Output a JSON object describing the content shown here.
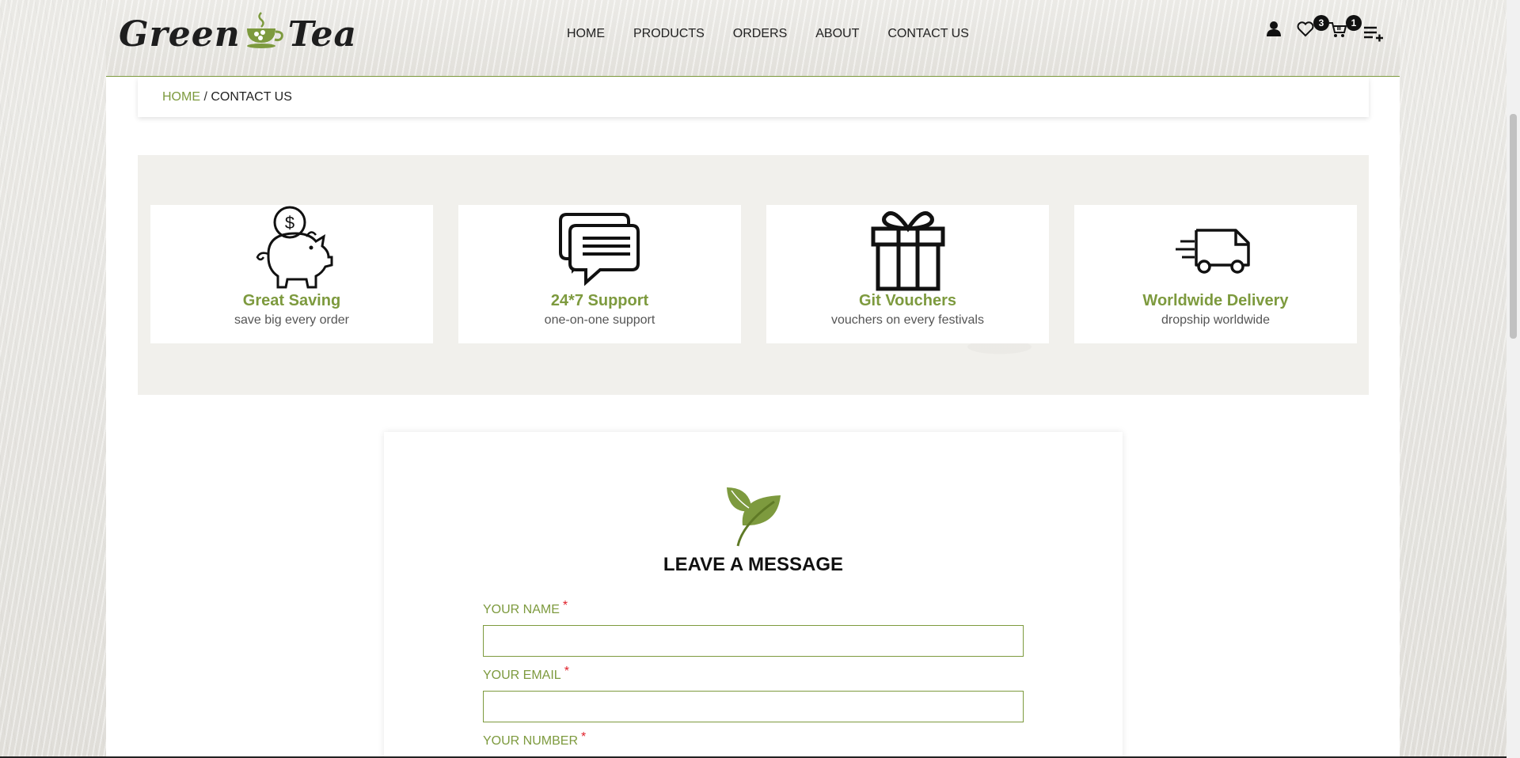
{
  "header": {
    "logo": {
      "word1": "Green",
      "word2": "Tea"
    },
    "nav": [
      "HOME",
      "PRODUCTS",
      "ORDERS",
      "ABOUT",
      "CONTACT US"
    ],
    "wishlist_count": "3",
    "cart_count": "1",
    "icons": [
      "user-icon",
      "heart-icon",
      "cart-icon",
      "list-plus-icon"
    ]
  },
  "breadcrumb": {
    "home": "HOME",
    "separator": "/",
    "current": "CONTACT US"
  },
  "features": [
    {
      "icon": "piggy-bank-icon",
      "title": "Great Saving",
      "subtitle": "save big every order"
    },
    {
      "icon": "chat-bubbles-icon",
      "title": "24*7 Support",
      "subtitle": "one-on-one support"
    },
    {
      "icon": "gift-icon",
      "title": "Git Vouchers",
      "subtitle": "vouchers on every festivals"
    },
    {
      "icon": "delivery-truck-icon",
      "title": "Worldwide Delivery",
      "subtitle": "dropship worldwide"
    }
  ],
  "form": {
    "icon": "leaf-icon",
    "title": "LEAVE A MESSAGE",
    "required_mark": "*",
    "fields": [
      {
        "label": "YOUR NAME",
        "value": ""
      },
      {
        "label": "YOUR EMAIL",
        "value": ""
      },
      {
        "label": "YOUR NUMBER",
        "value": ""
      }
    ]
  },
  "colors": {
    "accent": "#7d9a3e",
    "required": "#e0202a",
    "text": "#222222",
    "band": "#f1f0ec"
  }
}
